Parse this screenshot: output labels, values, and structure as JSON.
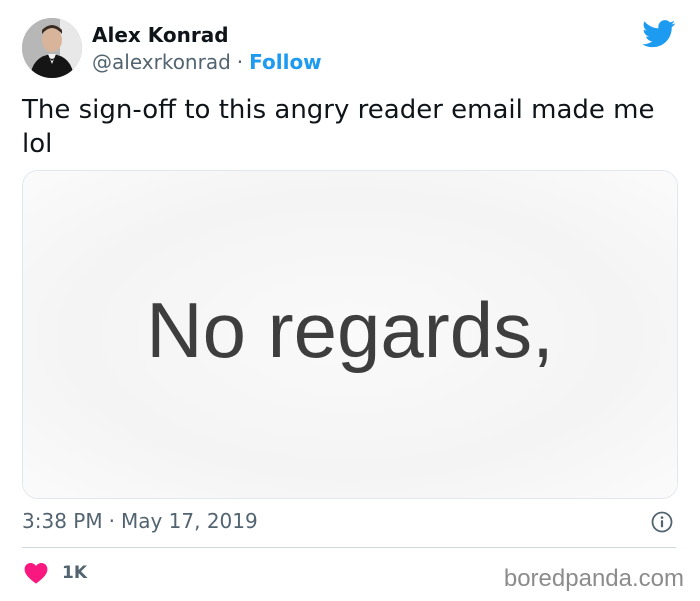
{
  "author": {
    "name": "Alex Konrad",
    "handle": "@alexrkonrad",
    "separator": "·",
    "follow_label": "Follow"
  },
  "tweet": {
    "text": "The sign-off to this angry reader email made me lol",
    "media_text": "No regards,"
  },
  "meta": {
    "time": "3:38 PM",
    "separator": "·",
    "date": "May 17, 2019"
  },
  "actions": {
    "like_count": "1K"
  },
  "watermark": "boredpanda.com",
  "colors": {
    "twitter_blue": "#1d9bf0",
    "like_red": "#f91880",
    "secondary_text": "#536471"
  },
  "icons": {
    "brand": "twitter-bird-icon",
    "info": "info-icon",
    "like": "heart-icon",
    "avatar": "user-avatar"
  }
}
